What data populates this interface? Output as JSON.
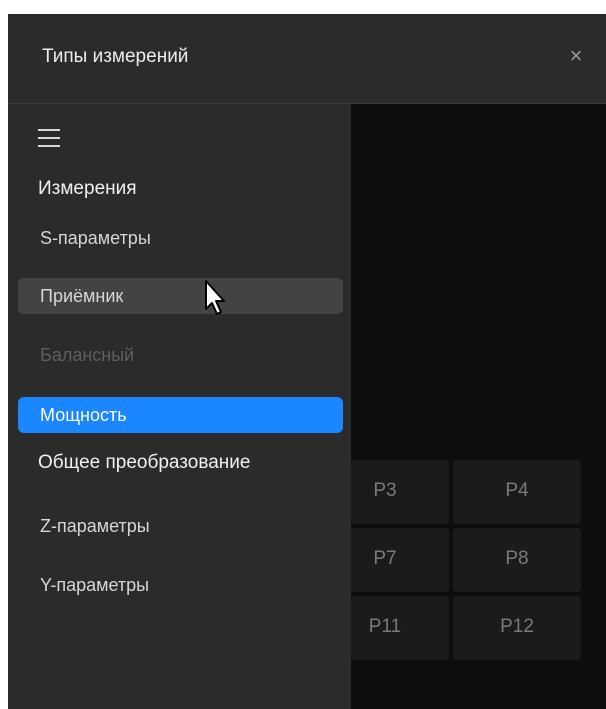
{
  "window": {
    "title": "Типы измерений",
    "close_symbol": "×"
  },
  "sidebar": {
    "menu_icon": "hamburger-menu-icon",
    "section_measurements": "Измерения",
    "items": [
      {
        "label": "S-параметры",
        "state": "normal"
      },
      {
        "label": "Приёмник",
        "state": "hover"
      },
      {
        "label": "Балансный",
        "state": "disabled"
      },
      {
        "label": "Мощность",
        "state": "selected"
      }
    ],
    "section_conversion": "Общее преобразование",
    "conversion_items": [
      {
        "label": "Z-параметры"
      },
      {
        "label": "Y-параметры"
      }
    ]
  },
  "port_grid": {
    "rows": [
      [
        "P3",
        "P4"
      ],
      [
        "P7",
        "P8"
      ],
      [
        "P11",
        "P12"
      ]
    ]
  },
  "colors": {
    "selected": "#1a86ff",
    "hover": "#434343",
    "panel": "#2b2b2b",
    "background": "#0e0e0e"
  }
}
